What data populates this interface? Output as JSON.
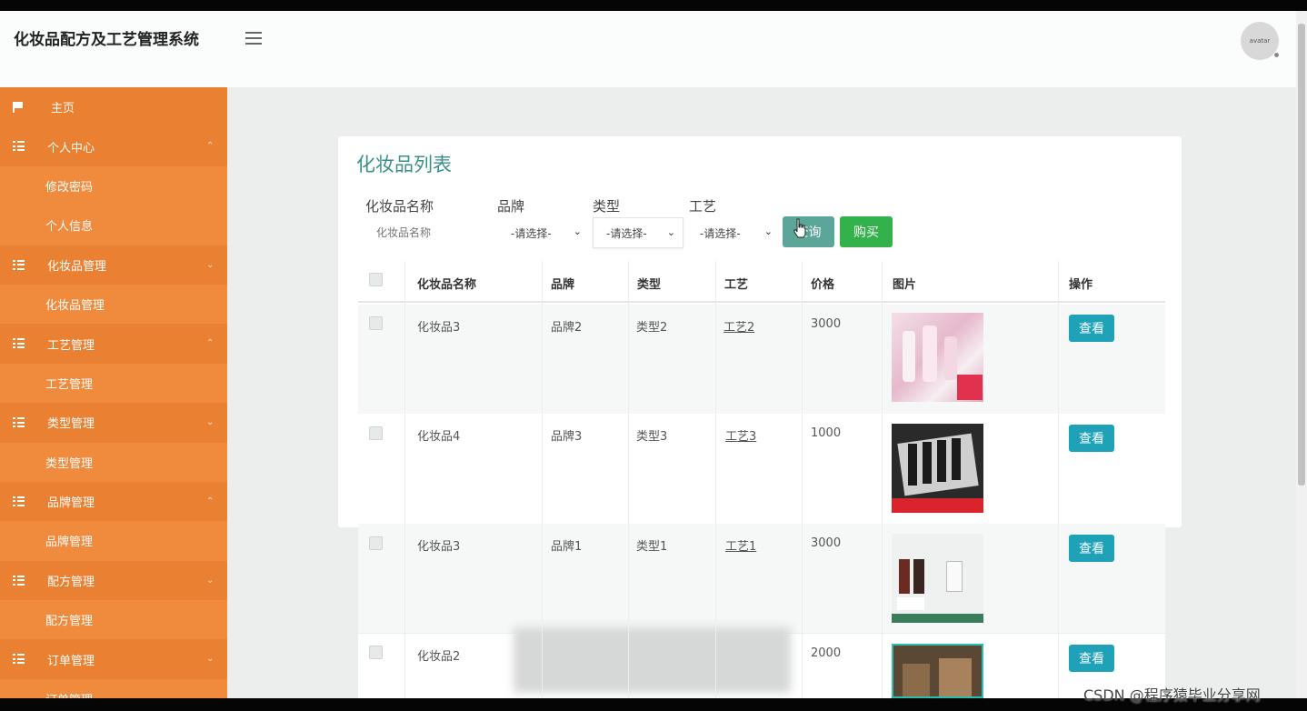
{
  "app": {
    "title": "化妆品配方及工艺管理系统",
    "avatar_text": "avatar"
  },
  "sidebar": {
    "items": [
      {
        "label": "主页",
        "kind": "home",
        "icon": "flag-icon"
      },
      {
        "label": "个人中心",
        "kind": "parent",
        "icon": "grid-icon",
        "chevron": "up"
      },
      {
        "label": "修改密码",
        "kind": "child"
      },
      {
        "label": "个人信息",
        "kind": "child"
      },
      {
        "label": "化妆品管理",
        "kind": "parent",
        "icon": "grid-icon",
        "chevron": "down"
      },
      {
        "label": "化妆品管理",
        "kind": "child"
      },
      {
        "label": "工艺管理",
        "kind": "parent",
        "icon": "grid-icon",
        "chevron": "up"
      },
      {
        "label": "工艺管理",
        "kind": "child"
      },
      {
        "label": "类型管理",
        "kind": "parent",
        "icon": "grid-icon",
        "chevron": "down"
      },
      {
        "label": "类型管理",
        "kind": "child"
      },
      {
        "label": "品牌管理",
        "kind": "parent",
        "icon": "grid-icon",
        "chevron": "up"
      },
      {
        "label": "品牌管理",
        "kind": "child"
      },
      {
        "label": "配方管理",
        "kind": "parent",
        "icon": "grid-icon",
        "chevron": "down"
      },
      {
        "label": "配方管理",
        "kind": "child"
      },
      {
        "label": "订单管理",
        "kind": "parent",
        "icon": "grid-icon",
        "chevron": "down"
      },
      {
        "label": "订单管理",
        "kind": "child"
      }
    ]
  },
  "page": {
    "title": "化妆品列表",
    "filters": {
      "name_label": "化妆品名称",
      "name_placeholder": "化妆品名称",
      "brand_label": "品牌",
      "brand_value": "-请选择-",
      "type_label": "类型",
      "type_value": "-请选择-",
      "craft_label": "工艺",
      "craft_value": "-请选择-"
    },
    "buttons": {
      "search": "查询",
      "buy": "购买",
      "view": "查看"
    },
    "table": {
      "headers": [
        "化妆品名称",
        "品牌",
        "类型",
        "工艺",
        "价格",
        "图片",
        "操作"
      ],
      "rows": [
        {
          "name": "化妆品3",
          "brand": "品牌2",
          "type": "类型2",
          "craft": "工艺2",
          "price": "3000"
        },
        {
          "name": "化妆品4",
          "brand": "品牌3",
          "type": "类型3",
          "craft": "工艺3",
          "price": "1000"
        },
        {
          "name": "化妆品3",
          "brand": "品牌1",
          "type": "类型1",
          "craft": "工艺1",
          "price": "3000"
        },
        {
          "name": "化妆品2",
          "brand": "",
          "type": "",
          "craft": "",
          "price": "2000"
        }
      ]
    }
  },
  "watermark": "CSDN @程序猿毕业分享网",
  "colors": {
    "sidebar": "#f08a3c",
    "accent_title": "#3a8f8a",
    "search_button": "#5ba599",
    "buy_button": "#33b14a",
    "view_button": "#1fa1b8"
  }
}
